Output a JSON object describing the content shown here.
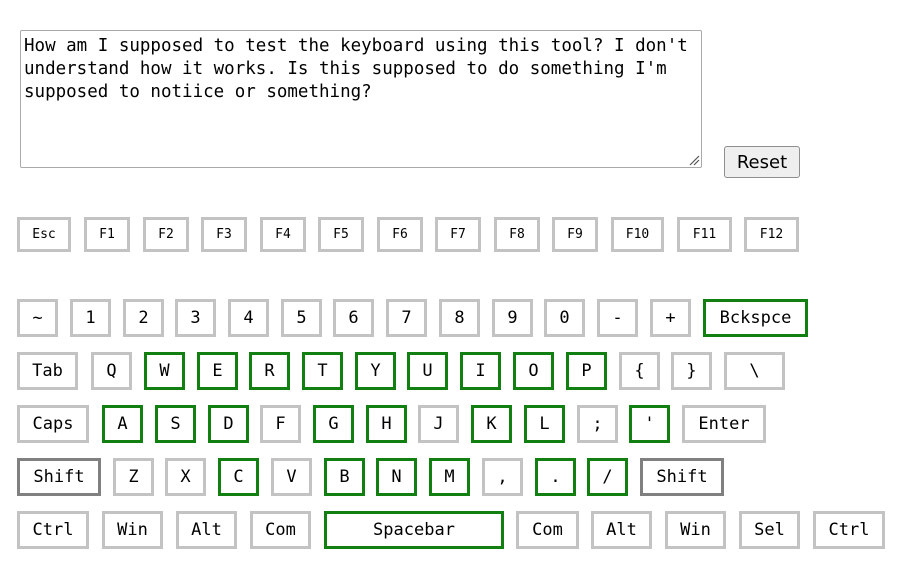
{
  "textarea": {
    "text": "How am I supposed to test the keyboard using this tool? I don't understand how it works. Is this supposed to do something I'm supposed to notiice or something?"
  },
  "reset_label": "Reset",
  "colors": {
    "key_border_default": "#c3c3c3",
    "key_border_pressed": "#118011",
    "key_border_held": "#808080"
  },
  "keyboard": {
    "function_row": [
      {
        "label": "Esc",
        "state": "default"
      },
      {
        "label": "F1",
        "state": "default"
      },
      {
        "label": "F2",
        "state": "default"
      },
      {
        "label": "F3",
        "state": "default"
      },
      {
        "label": "F4",
        "state": "default"
      },
      {
        "label": "F5",
        "state": "default"
      },
      {
        "label": "F6",
        "state": "default"
      },
      {
        "label": "F7",
        "state": "default"
      },
      {
        "label": "F8",
        "state": "default"
      },
      {
        "label": "F9",
        "state": "default"
      },
      {
        "label": "F10",
        "state": "default"
      },
      {
        "label": "F11",
        "state": "default"
      },
      {
        "label": "F12",
        "state": "default"
      }
    ],
    "number_row": [
      {
        "label": "~",
        "state": "default"
      },
      {
        "label": "1",
        "state": "default"
      },
      {
        "label": "2",
        "state": "default"
      },
      {
        "label": "3",
        "state": "default"
      },
      {
        "label": "4",
        "state": "default"
      },
      {
        "label": "5",
        "state": "default"
      },
      {
        "label": "6",
        "state": "default"
      },
      {
        "label": "7",
        "state": "default"
      },
      {
        "label": "8",
        "state": "default"
      },
      {
        "label": "9",
        "state": "default"
      },
      {
        "label": "0",
        "state": "default"
      },
      {
        "label": "-",
        "state": "default"
      },
      {
        "label": "+",
        "state": "default"
      },
      {
        "label": "Bckspce",
        "state": "pressed"
      }
    ],
    "top_row": [
      {
        "label": "Tab",
        "state": "default"
      },
      {
        "label": "Q",
        "state": "default"
      },
      {
        "label": "W",
        "state": "pressed"
      },
      {
        "label": "E",
        "state": "pressed"
      },
      {
        "label": "R",
        "state": "pressed"
      },
      {
        "label": "T",
        "state": "pressed"
      },
      {
        "label": "Y",
        "state": "pressed"
      },
      {
        "label": "U",
        "state": "pressed"
      },
      {
        "label": "I",
        "state": "pressed"
      },
      {
        "label": "O",
        "state": "pressed"
      },
      {
        "label": "P",
        "state": "pressed"
      },
      {
        "label": "{",
        "state": "default"
      },
      {
        "label": "}",
        "state": "default"
      },
      {
        "label": "\\",
        "state": "default"
      }
    ],
    "home_row": [
      {
        "label": "Caps",
        "state": "default"
      },
      {
        "label": "A",
        "state": "pressed"
      },
      {
        "label": "S",
        "state": "pressed"
      },
      {
        "label": "D",
        "state": "pressed"
      },
      {
        "label": "F",
        "state": "default"
      },
      {
        "label": "G",
        "state": "pressed"
      },
      {
        "label": "H",
        "state": "pressed"
      },
      {
        "label": "J",
        "state": "default"
      },
      {
        "label": "K",
        "state": "pressed"
      },
      {
        "label": "L",
        "state": "pressed"
      },
      {
        "label": ";",
        "state": "default"
      },
      {
        "label": "'",
        "state": "pressed"
      },
      {
        "label": "Enter",
        "state": "default"
      }
    ],
    "shift_row": [
      {
        "label": "Shift",
        "state": "held"
      },
      {
        "label": "Z",
        "state": "default"
      },
      {
        "label": "X",
        "state": "default"
      },
      {
        "label": "C",
        "state": "pressed"
      },
      {
        "label": "V",
        "state": "default"
      },
      {
        "label": "B",
        "state": "pressed"
      },
      {
        "label": "N",
        "state": "pressed"
      },
      {
        "label": "M",
        "state": "pressed"
      },
      {
        "label": ",",
        "state": "default"
      },
      {
        "label": ".",
        "state": "pressed"
      },
      {
        "label": "/",
        "state": "pressed"
      },
      {
        "label": "Shift",
        "state": "held"
      }
    ],
    "bottom_row": [
      {
        "label": "Ctrl",
        "state": "default"
      },
      {
        "label": "Win",
        "state": "default"
      },
      {
        "label": "Alt",
        "state": "default"
      },
      {
        "label": "Com",
        "state": "default"
      },
      {
        "label": "Spacebar",
        "state": "pressed"
      },
      {
        "label": "Com",
        "state": "default"
      },
      {
        "label": "Alt",
        "state": "default"
      },
      {
        "label": "Win",
        "state": "default"
      },
      {
        "label": "Sel",
        "state": "default"
      },
      {
        "label": "Ctrl",
        "state": "default"
      }
    ]
  }
}
